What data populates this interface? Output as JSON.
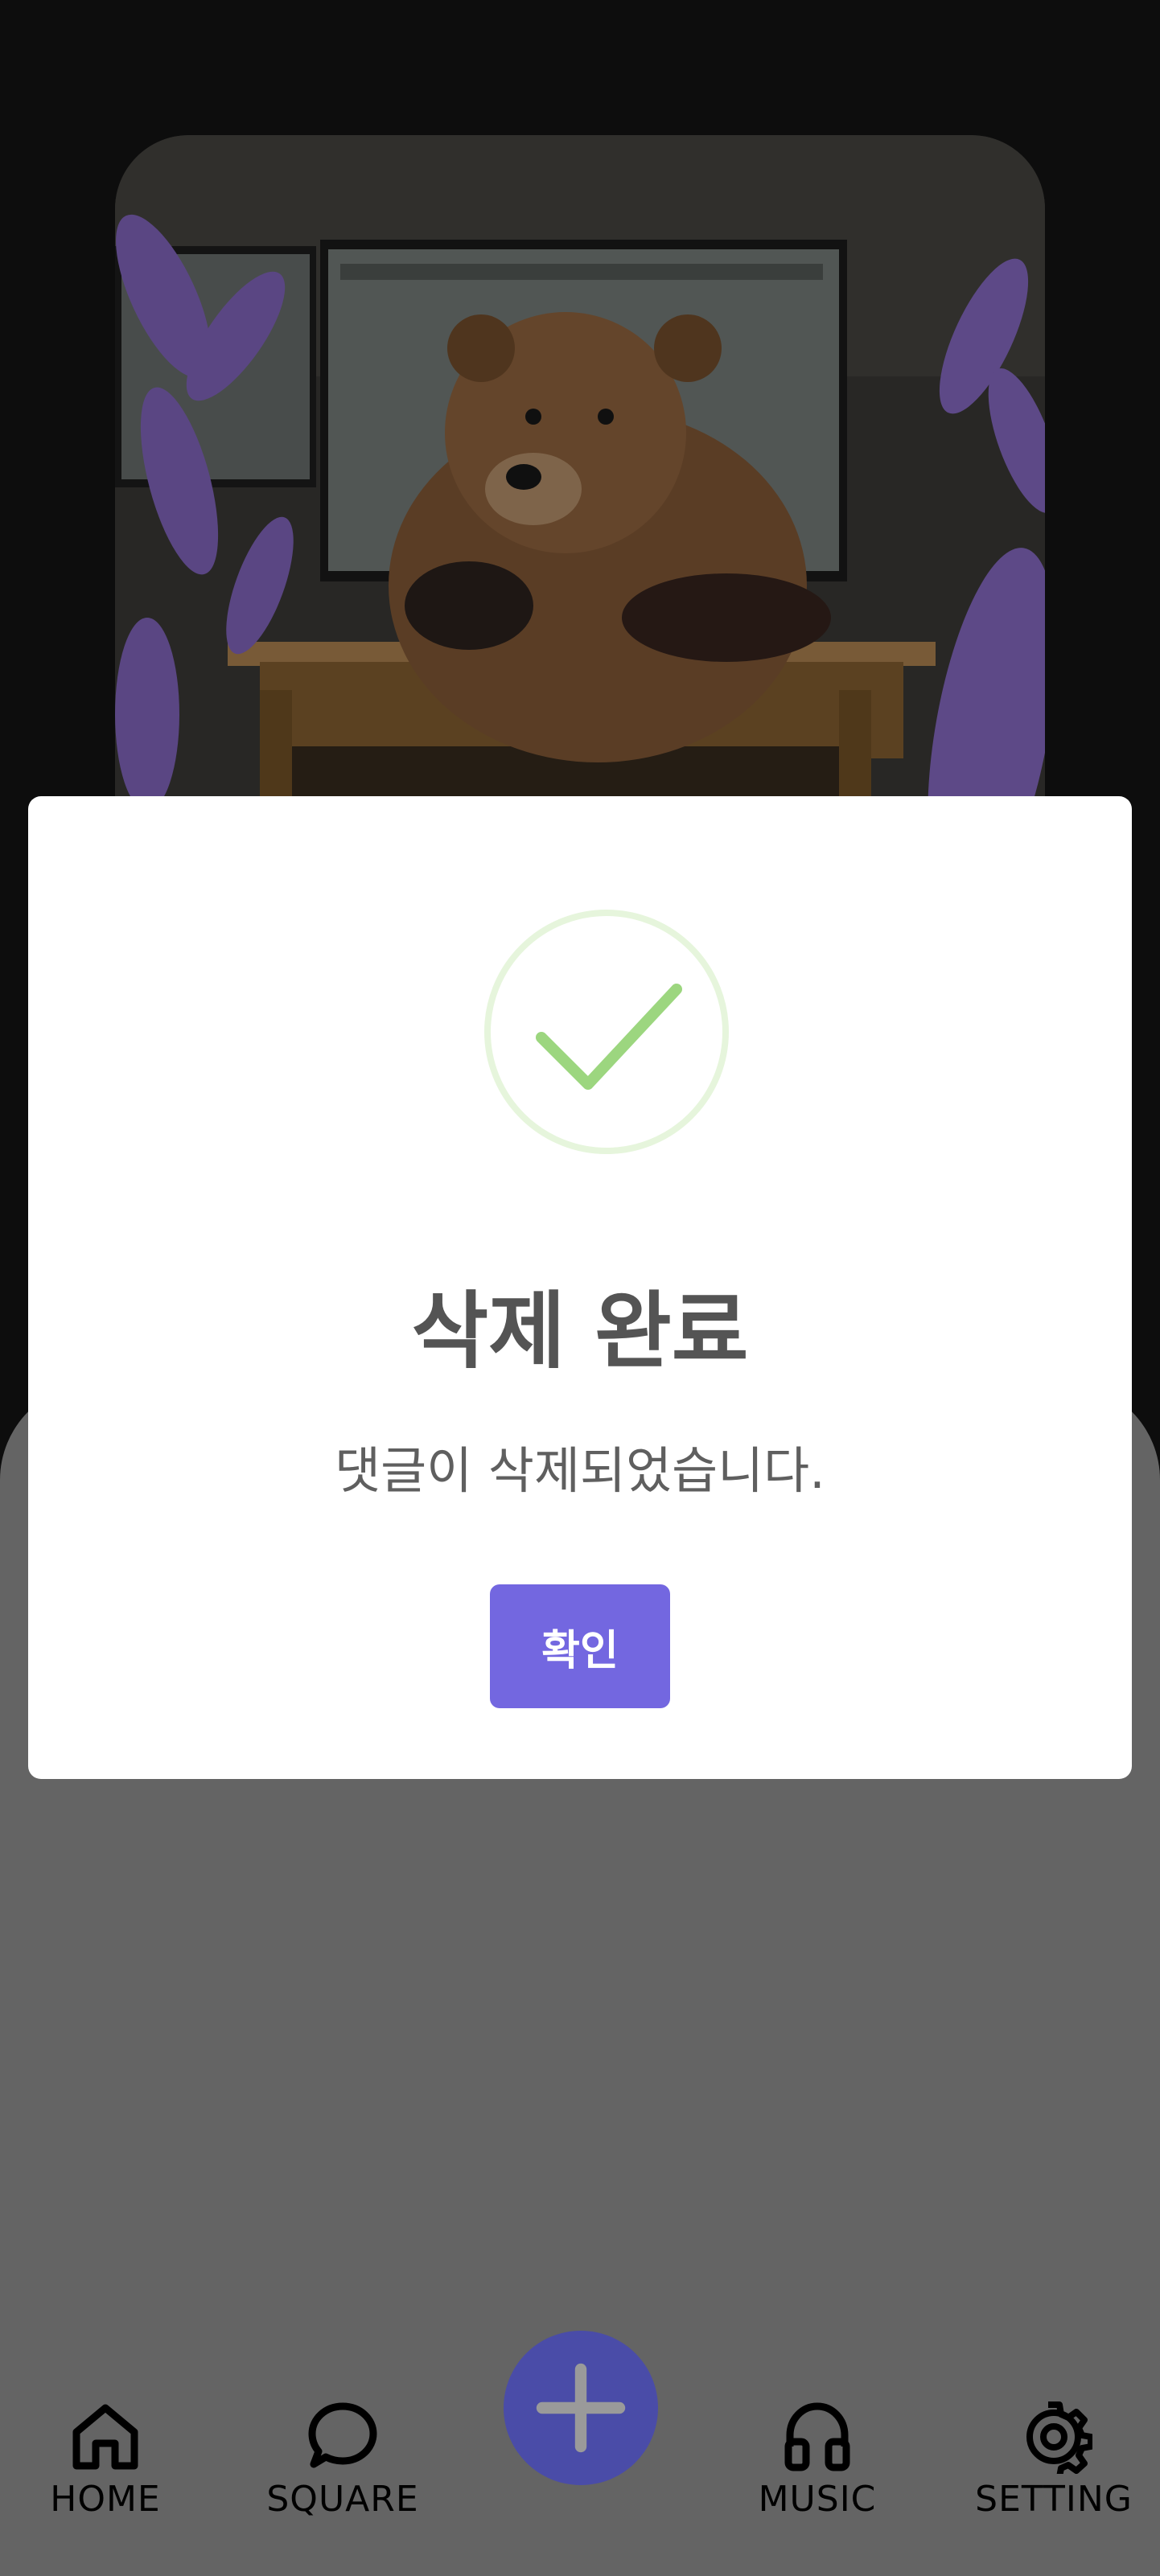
{
  "background": {
    "artwork": "bear-at-desk-with-lavender"
  },
  "modal": {
    "icon": "check-circle-icon",
    "title": "삭제 완료",
    "message": "댓글이 삭제되었습니다.",
    "confirm_label": "확인",
    "accent_color": "#7367e0",
    "success_color": "#9cd67f"
  },
  "nav": {
    "items": [
      {
        "label": "HOME",
        "icon": "home-icon"
      },
      {
        "label": "SQUARE",
        "icon": "chat-bubble-icon"
      },
      {
        "label": "MUSIC",
        "icon": "headphones-icon"
      },
      {
        "label": "SETTING",
        "icon": "gear-icon"
      }
    ],
    "fab_icon": "plus-icon",
    "fab_color": "#4a4ca8"
  }
}
